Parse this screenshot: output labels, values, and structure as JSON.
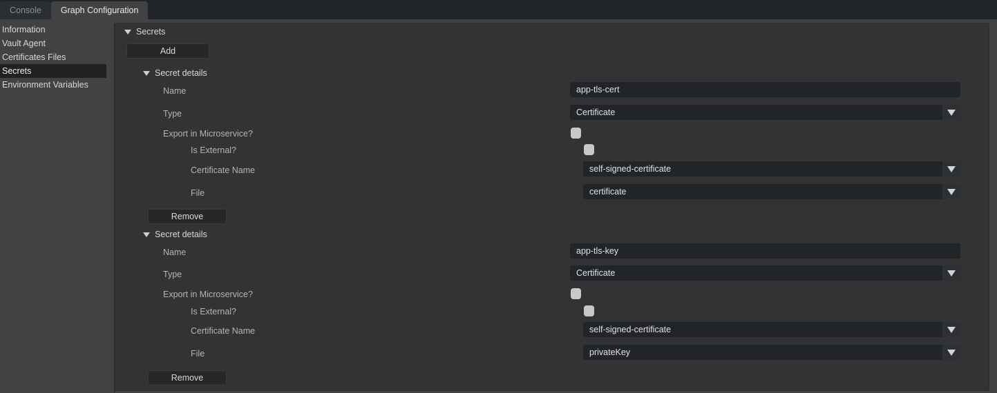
{
  "tabs": [
    {
      "label": "Console",
      "active": false
    },
    {
      "label": "Graph Configuration",
      "active": true
    }
  ],
  "sidebar": {
    "items": [
      {
        "label": "Information",
        "selected": false
      },
      {
        "label": "Vault Agent",
        "selected": false
      },
      {
        "label": "Certificates Files",
        "selected": false
      },
      {
        "label": "Secrets",
        "selected": true
      },
      {
        "label": "Environment Variables",
        "selected": false
      }
    ]
  },
  "panel": {
    "section_title": "Secrets",
    "add_label": "Add",
    "remove_label": "Remove",
    "labels": {
      "secret_details": "Secret details",
      "name": "Name",
      "type": "Type",
      "export_in_microservice": "Export in Microservice?",
      "is_external": "Is External?",
      "certificate_name": "Certificate Name",
      "file": "File"
    },
    "secrets": [
      {
        "name_value": "app-tls-cert",
        "name_placeholder": "",
        "type_value": "Certificate",
        "export_in_microservice_checked": false,
        "is_external_checked": false,
        "certificate_name_value": "self-signed-certificate",
        "file_value": "certificate"
      },
      {
        "name_value": "app-tls-key",
        "name_placeholder": "",
        "type_value": "Certificate",
        "export_in_microservice_checked": false,
        "is_external_checked": false,
        "certificate_name_value": "self-signed-certificate",
        "file_value": "privateKey"
      }
    ]
  },
  "colors": {
    "window_bg": "#212529",
    "chrome": "#424242",
    "panel_bg": "#333333",
    "field_bg": "#212529",
    "button_bg": "#272727",
    "selected_item_bg": "#212121",
    "text": "#d8d8d8",
    "label_text": "#b4b4b4",
    "checkbox": "#c8c8c8"
  }
}
